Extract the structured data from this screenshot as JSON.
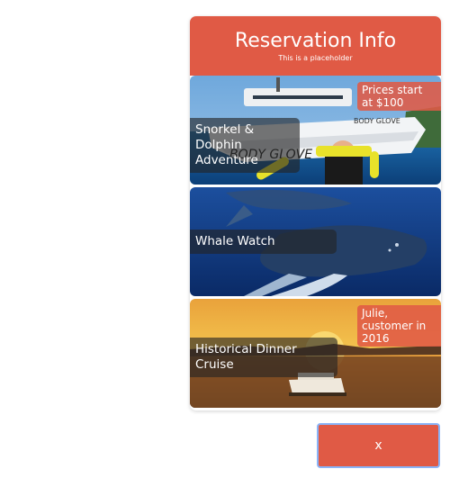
{
  "header": {
    "title": "Reservation Info",
    "subtitle": "This is a placeholder"
  },
  "cards": [
    {
      "title": "Snorkel & Dolphin Adventure",
      "badge": "Prices start at $100",
      "image": "snorkel-boat-photo"
    },
    {
      "title": "Whale Watch",
      "image": "humpback-whales-photo"
    },
    {
      "title": "Historical Dinner Cruise",
      "badge": "Julie, customer in 2016",
      "image": "sunset-cruise-photo"
    }
  ],
  "close_button": {
    "label": "x"
  },
  "colors": {
    "accent": "#e05a45",
    "focus_ring": "#8ab4f8"
  }
}
